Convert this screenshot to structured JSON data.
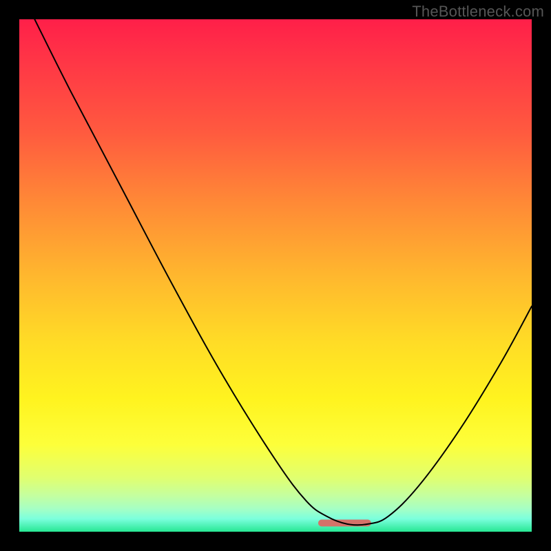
{
  "watermark": "TheBottleneck.com",
  "chart_data": {
    "type": "line",
    "title": "",
    "xlabel": "",
    "ylabel": "",
    "xlim": [
      0,
      100
    ],
    "ylim": [
      0,
      100
    ],
    "series": [
      {
        "name": "bottleneck-curve",
        "x": [
          3,
          10,
          20,
          30,
          40,
          50,
          56,
          60,
          64,
          68,
          72,
          78,
          86,
          94,
          100
        ],
        "values": [
          100,
          86,
          67,
          48,
          30,
          14,
          6,
          3,
          1.5,
          1.5,
          3,
          9,
          20,
          33,
          44
        ],
        "color": "#000000"
      },
      {
        "name": "optimal-zone",
        "x": [
          59,
          68
        ],
        "values": [
          1.7,
          1.7
        ],
        "color": "#d57269"
      }
    ],
    "gradient_stops": [
      {
        "pos": 0,
        "color": "#ff1f49"
      },
      {
        "pos": 0.5,
        "color": "#ffdc26"
      },
      {
        "pos": 0.83,
        "color": "#fdff3a"
      },
      {
        "pos": 1.0,
        "color": "#27e793"
      }
    ],
    "grid": false,
    "legend": false
  }
}
